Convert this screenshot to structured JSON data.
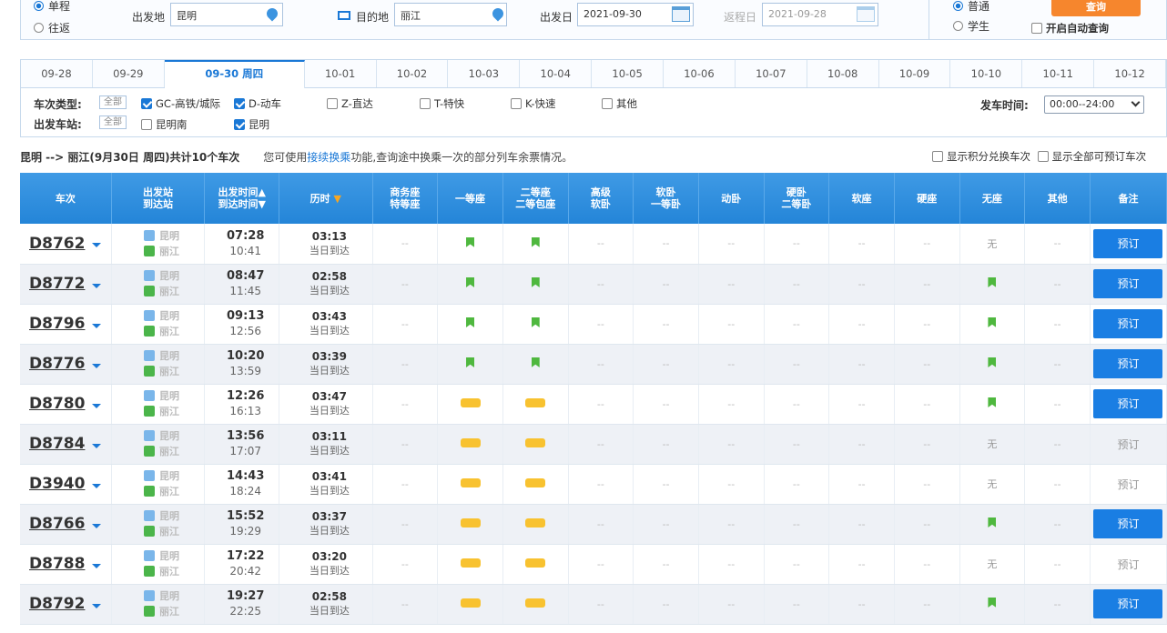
{
  "search": {
    "one_way_label": "单程",
    "round_trip_label": "往返",
    "from_label": "出发地",
    "from_value": "昆明",
    "to_label": "目的地",
    "to_value": "丽江",
    "date_label": "出发日",
    "date_value": "2021-09-30",
    "return_label": "返程日",
    "return_value": "2021-09-28",
    "passenger_normal": "普通",
    "passenger_student": "学生",
    "query_button": "查询",
    "auto_query_label": "开启自动查询"
  },
  "date_tabs": [
    "09-28",
    "09-29",
    "09-30 周四",
    "10-01",
    "10-02",
    "10-03",
    "10-04",
    "10-05",
    "10-06",
    "10-07",
    "10-08",
    "10-09",
    "10-10",
    "10-11",
    "10-12"
  ],
  "filters": {
    "type_label": "车次类型:",
    "all_label": "全部",
    "types": [
      "GC-高铁/城际",
      "D-动车",
      "Z-直达",
      "T-特快",
      "K-快速",
      "其他"
    ],
    "station_label": "出发车站:",
    "stations": [
      "昆明南",
      "昆明"
    ],
    "depart_time_label": "发车时间:",
    "depart_time_value": "00:00--24:00"
  },
  "summary": {
    "route": "昆明 --> 丽江(9月30日 周四)共计10个车次",
    "tip_prefix": "您可使用",
    "tip_link": "接续换乘",
    "tip_suffix": "功能,查询途中换乘一次的部分列车余票情况。",
    "points_label": "显示积分兑换车次",
    "all_bookable_label": "显示全部可预订车次"
  },
  "table": {
    "headers": {
      "train": "车次",
      "station_top": "出发站",
      "station_bottom": "到达站",
      "time_top": "出发时间▲",
      "time_bottom": "到达时间▼",
      "duration": "历时",
      "business": [
        "商务座",
        "特等座"
      ],
      "first": "一等座",
      "second": [
        "二等座",
        "二等包座"
      ],
      "premium_soft": [
        "高级",
        "软卧"
      ],
      "soft_sleeper": [
        "软卧",
        "一等卧"
      ],
      "moving_sleeper": "动卧",
      "hard_sleeper": [
        "硬卧",
        "二等卧"
      ],
      "soft_seat": "软座",
      "hard_seat": "硬座",
      "no_seat": "无座",
      "other": "其他",
      "remark": "备注"
    },
    "book_label": "预订",
    "none_label": "无",
    "dash": "--",
    "arrive_same_day": "当日到达",
    "rows": [
      {
        "train": "D8762",
        "from": "昆明",
        "to": "丽江",
        "dep": "07:28",
        "arr": "10:41",
        "dur": "03:13",
        "first": "have",
        "second": "have",
        "noseat": "none",
        "book": true
      },
      {
        "train": "D8772",
        "from": "昆明",
        "to": "丽江",
        "dep": "08:47",
        "arr": "11:45",
        "dur": "02:58",
        "first": "have",
        "second": "have",
        "noseat": "have",
        "book": true
      },
      {
        "train": "D8796",
        "from": "昆明",
        "to": "丽江",
        "dep": "09:13",
        "arr": "12:56",
        "dur": "03:43",
        "first": "have",
        "second": "have",
        "noseat": "have",
        "book": true
      },
      {
        "train": "D8776",
        "from": "昆明",
        "to": "丽江",
        "dep": "10:20",
        "arr": "13:59",
        "dur": "03:39",
        "first": "have",
        "second": "have",
        "noseat": "have",
        "book": true
      },
      {
        "train": "D8780",
        "from": "昆明",
        "to": "丽江",
        "dep": "12:26",
        "arr": "16:13",
        "dur": "03:47",
        "first": "few",
        "second": "few",
        "noseat": "have",
        "book": true
      },
      {
        "train": "D8784",
        "from": "昆明",
        "to": "丽江",
        "dep": "13:56",
        "arr": "17:07",
        "dur": "03:11",
        "first": "few",
        "second": "few",
        "noseat": "none",
        "book": false
      },
      {
        "train": "D3940",
        "from": "昆明",
        "to": "丽江",
        "dep": "14:43",
        "arr": "18:24",
        "dur": "03:41",
        "first": "few",
        "second": "few",
        "noseat": "none",
        "book": false
      },
      {
        "train": "D8766",
        "from": "昆明",
        "to": "丽江",
        "dep": "15:52",
        "arr": "19:29",
        "dur": "03:37",
        "first": "few",
        "second": "few",
        "noseat": "have",
        "book": true
      },
      {
        "train": "D8788",
        "from": "昆明",
        "to": "丽江",
        "dep": "17:22",
        "arr": "20:42",
        "dur": "03:20",
        "first": "few",
        "second": "few",
        "noseat": "none",
        "book": false
      },
      {
        "train": "D8792",
        "from": "昆明",
        "to": "丽江",
        "dep": "19:27",
        "arr": "22:25",
        "dur": "02:58",
        "first": "few",
        "second": "few",
        "noseat": "have",
        "book": true
      }
    ]
  },
  "colors": {
    "accent": "#1a78d6",
    "header": "#2485d8",
    "have": "#4fb83f",
    "few": "#f8c230",
    "query": "#f6862d"
  }
}
